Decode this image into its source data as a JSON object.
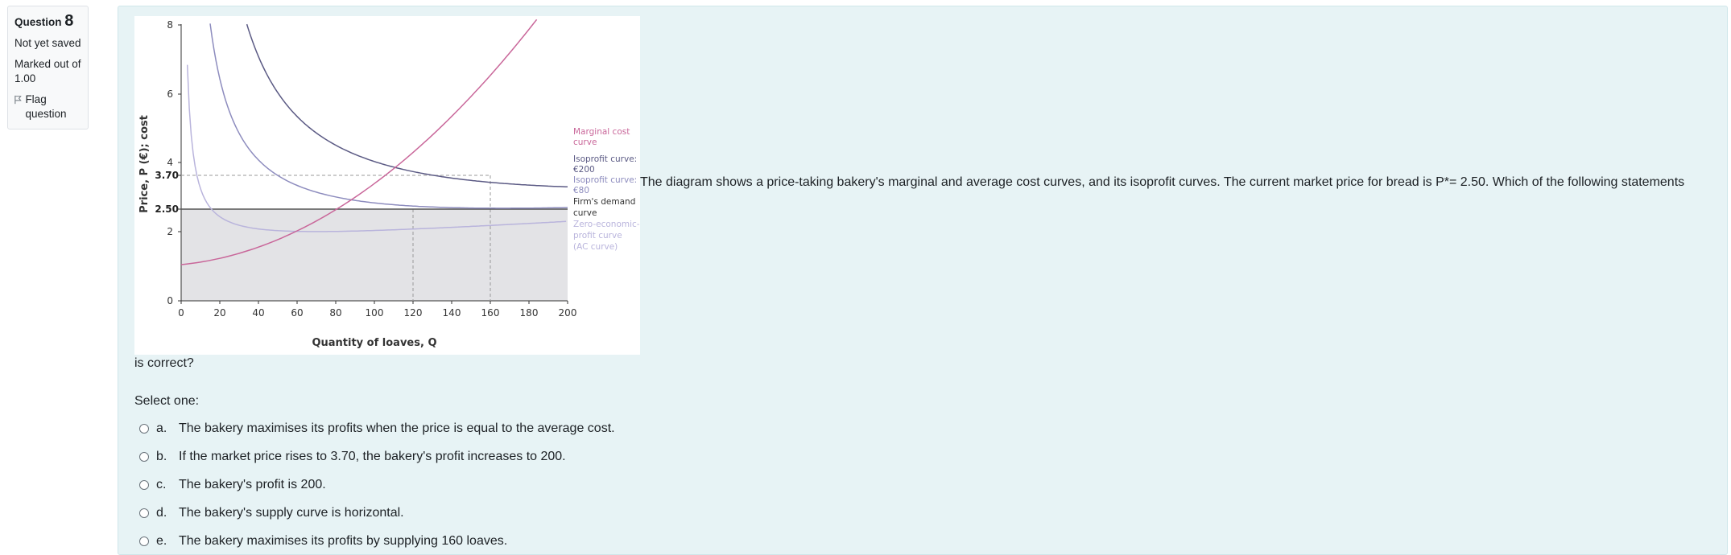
{
  "info": {
    "question_word": "Question",
    "question_number": "8",
    "status": "Not yet saved",
    "marks": "Marked out of 1.00",
    "flag_label": "Flag question"
  },
  "question": {
    "text_part1": "The diagram shows a price-taking bakery's marginal and average cost curves, and its isoprofit curves. The current market price for bread is P*= 2.50. Which of the following statements",
    "text_part2": "is correct?",
    "prompt": "Select one:",
    "options": [
      {
        "letter": "a.",
        "text": "The bakery maximises its profits when the price is equal to the average cost."
      },
      {
        "letter": "b.",
        "text": "If the market price rises to 3.70, the bakery's profit increases to 200."
      },
      {
        "letter": "c.",
        "text": "The bakery's profit is 200."
      },
      {
        "letter": "d.",
        "text": "The bakery's supply curve is horizontal."
      },
      {
        "letter": "e.",
        "text": "The bakery maximises its profits by supplying 160 loaves."
      }
    ]
  },
  "figure": {
    "ylabel": "Price, P (€); cost",
    "xlabel": "Quantity of loaves, Q",
    "y_ticks": [
      "0",
      "2",
      "4",
      "6",
      "8"
    ],
    "y_special": [
      "2.50",
      "3.70"
    ],
    "x_ticks": [
      "0",
      "20",
      "40",
      "60",
      "80",
      "100",
      "120",
      "140",
      "160",
      "180",
      "200"
    ],
    "legend": {
      "mc": [
        "Marginal cost",
        "curve"
      ],
      "iso200": [
        "Isoprofit curve:",
        "€200"
      ],
      "iso80": [
        "Isoprofit curve:",
        "€80"
      ],
      "demand": [
        "Firm's demand",
        "curve"
      ],
      "ac": [
        "Zero-economic-",
        "profit curve",
        "(AC curve)"
      ]
    },
    "colors": {
      "mc": "#c9679a",
      "iso200": "#5b5a84",
      "iso80": "#8d8cbe",
      "ac": "#b9b4dc",
      "demand": "#555555",
      "shade": "#e3e3e6"
    }
  }
}
